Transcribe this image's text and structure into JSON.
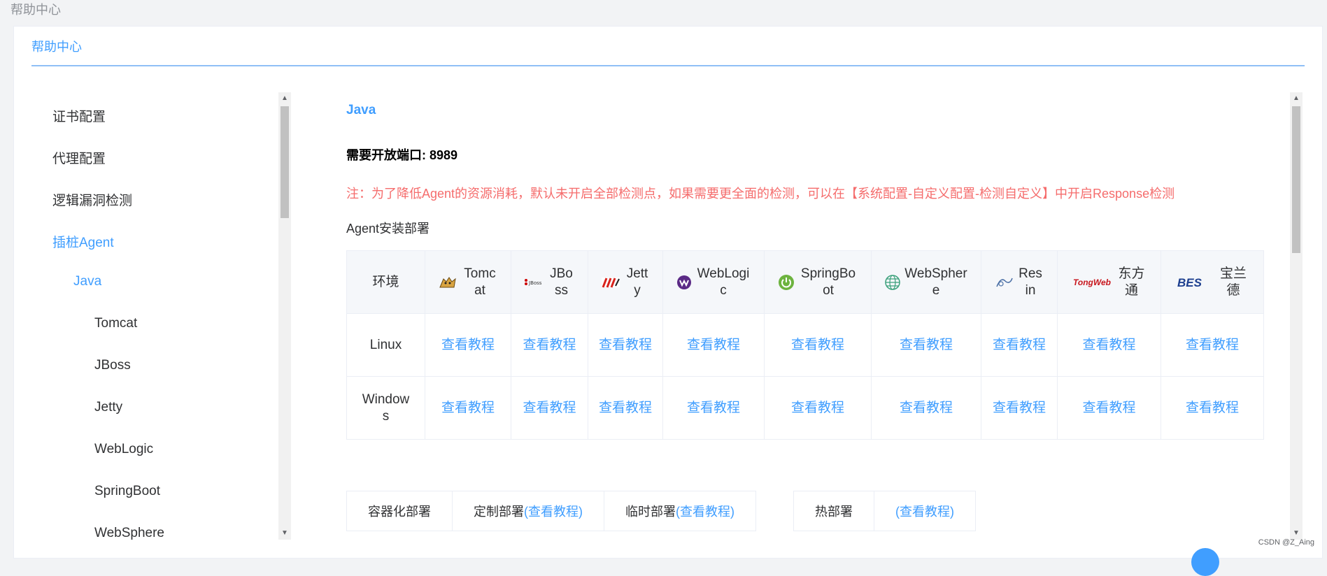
{
  "breadcrumb": "帮助中心",
  "card_title": "帮助中心",
  "sidebar": {
    "items": [
      {
        "label": "证书配置",
        "level": 0,
        "active": false
      },
      {
        "label": "代理配置",
        "level": 0,
        "active": false
      },
      {
        "label": "逻辑漏洞检测",
        "level": 0,
        "active": false
      },
      {
        "label": "插桩Agent",
        "level": 0,
        "active": true
      },
      {
        "label": "Java",
        "level": 1,
        "active": true
      },
      {
        "label": "Tomcat",
        "level": 2,
        "active": false
      },
      {
        "label": "JBoss",
        "level": 2,
        "active": false
      },
      {
        "label": "Jetty",
        "level": 2,
        "active": false
      },
      {
        "label": "WebLogic",
        "level": 2,
        "active": false
      },
      {
        "label": "SpringBoot",
        "level": 2,
        "active": false
      },
      {
        "label": "WebSphere",
        "level": 2,
        "active": false
      }
    ]
  },
  "content": {
    "heading": "Java",
    "port_text": "需要开放端口: 8989",
    "note": "注：为了降低Agent的资源消耗，默认未开启全部检测点，如果需要更全面的检测，可以在【系统配置-自定义配置-检测自定义】中开启Response检测",
    "deploy_title": "Agent安装部署",
    "table": {
      "env_header": "环境",
      "servers": [
        "Tomcat",
        "JBoss",
        "Jetty",
        "WebLogic",
        "SpringBoot",
        "WebSphere",
        "Resin",
        "东方通",
        "宝兰德"
      ],
      "logo_texts": {
        "jboss": "JBoss",
        "tongweb": "TongWeb",
        "bes": "BES"
      },
      "rows": [
        {
          "env": "Linux",
          "link": "查看教程"
        },
        {
          "env": "Windows",
          "link": "查看教程"
        }
      ]
    },
    "bottom": {
      "containerized": "容器化部署",
      "custom": "定制部署",
      "temporary": "临时部署",
      "hot": "热部署",
      "link": "(查看教程)"
    }
  },
  "watermark": "CSDN @Z_Aing"
}
